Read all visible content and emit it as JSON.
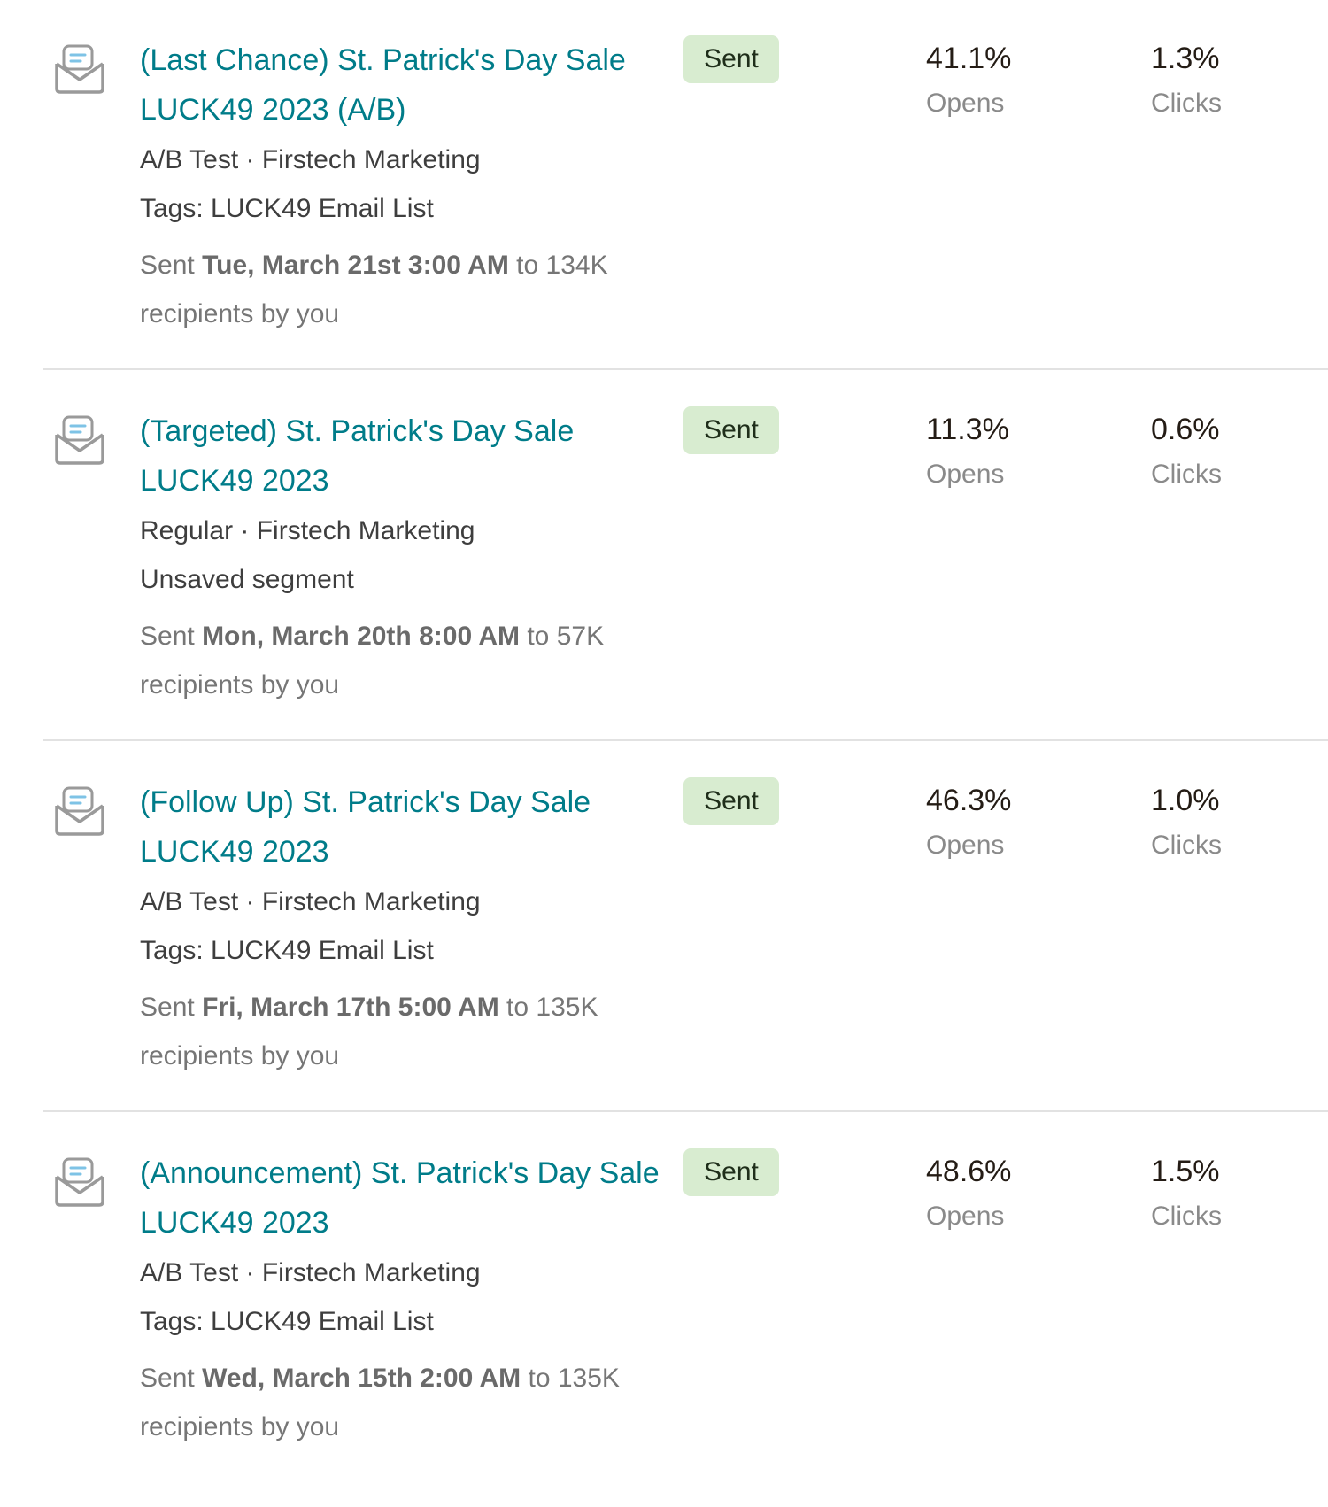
{
  "campaigns": [
    {
      "title": "(Last Chance) St. Patrick's Day Sale LUCK49 2023 (A/B)",
      "status": "Sent",
      "type_line": "A/B Test · Firstech Marketing",
      "audience_line": "Tags: LUCK49 Email List",
      "sent_prefix": "Sent ",
      "sent_date": "Tue, March 21st 3:00 AM",
      "sent_suffix": " to 134K recipients by you",
      "opens_value": "41.1%",
      "opens_label": "Opens",
      "clicks_value": "1.3%",
      "clicks_label": "Clicks"
    },
    {
      "title": "(Targeted) St. Patrick's Day Sale LUCK49 2023",
      "status": "Sent",
      "type_line": "Regular · Firstech Marketing",
      "audience_line": "Unsaved segment",
      "sent_prefix": "Sent ",
      "sent_date": "Mon, March 20th 8:00 AM",
      "sent_suffix": " to 57K recipients by you",
      "opens_value": "11.3%",
      "opens_label": "Opens",
      "clicks_value": "0.6%",
      "clicks_label": "Clicks"
    },
    {
      "title": "(Follow Up) St. Patrick's Day Sale LUCK49 2023",
      "status": "Sent",
      "type_line": "A/B Test · Firstech Marketing",
      "audience_line": "Tags: LUCK49 Email List",
      "sent_prefix": "Sent ",
      "sent_date": "Fri, March 17th 5:00 AM",
      "sent_suffix": " to 135K recipients by you",
      "opens_value": "46.3%",
      "opens_label": "Opens",
      "clicks_value": "1.0%",
      "clicks_label": "Clicks"
    },
    {
      "title": "(Announcement) St. Patrick's Day Sale LUCK49 2023",
      "status": "Sent",
      "type_line": "A/B Test · Firstech Marketing",
      "audience_line": "Tags: LUCK49 Email List",
      "sent_prefix": "Sent ",
      "sent_date": "Wed, March 15th 2:00 AM",
      "sent_suffix": " to 135K recipients by you",
      "opens_value": "48.6%",
      "opens_label": "Opens",
      "clicks_value": "1.5%",
      "clicks_label": "Clicks"
    }
  ],
  "icons": {
    "campaign_icon": "email-campaign-envelope-icon"
  },
  "colors": {
    "title_link": "#007c89",
    "badge_background": "#d8ecd0",
    "icon_outline": "#9a9a9a",
    "icon_accent": "#7ec3e6"
  }
}
